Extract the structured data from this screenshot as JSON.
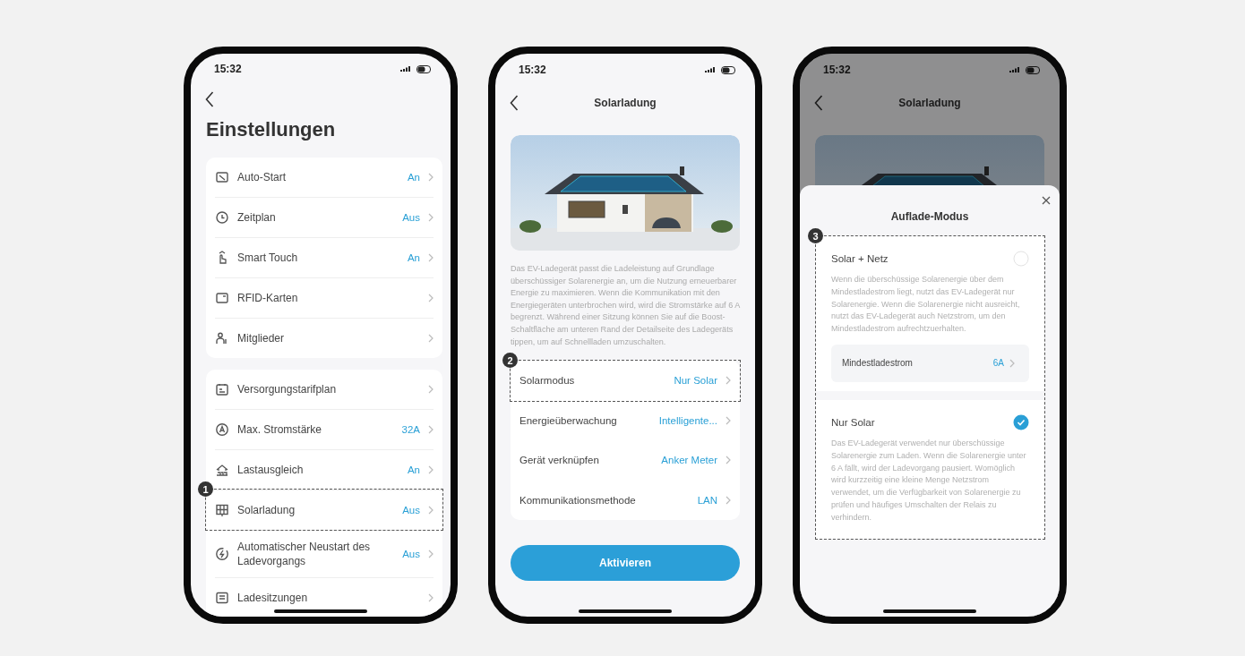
{
  "screens": [
    {
      "kind": "settings",
      "status_time": "15:32",
      "title": "Einstellungen",
      "groups": [
        [
          {
            "label": "Auto-Start",
            "value": "An"
          },
          {
            "label": "Zeitplan",
            "value": "Aus"
          },
          {
            "label": "Smart Touch",
            "value": "An"
          },
          {
            "label": "RFID-Karten"
          },
          {
            "label": "Mitglieder"
          }
        ],
        [
          {
            "label": "Versorgungstarifplan"
          },
          {
            "label": "Max. Stromstärke",
            "value": "32A"
          },
          {
            "label": "Lastausgleich",
            "value": "An"
          },
          {
            "label": "Solarladung",
            "value": "Aus",
            "callout": "1"
          },
          {
            "label": "Automatischer Neustart des Ladevorgangs",
            "value": "Aus"
          },
          {
            "label": "Ladesitzungen"
          }
        ]
      ]
    },
    {
      "kind": "detail",
      "status_time": "15:32",
      "title": "Solarladung",
      "description": "Das EV-Ladegerät passt die Ladeleistung auf Grundlage überschüssiger Solarenergie an, um die Nutzung erneuerbarer Energie zu maximieren. Wenn die Kommunikation mit den Energiegeräten unterbrochen wird, wird die Stromstärke auf 6 A begrenzt. Während einer Sitzung können Sie auf die Boost-Schaltfläche am unteren Rand der Detailseite des Ladegeräts tippen, um auf Schnellladen umzuschalten.",
      "rows": [
        {
          "label": "Solarmodus",
          "value": "Nur Solar",
          "callout": "2"
        },
        {
          "label": "Energieüberwachung",
          "value": "Intelligente..."
        },
        {
          "label": "Gerät verknüpfen",
          "value": "Anker Meter"
        },
        {
          "label": "Kommunikationsmethode",
          "value": "LAN"
        }
      ],
      "button": "Aktivieren"
    },
    {
      "kind": "sheet",
      "status_time": "15:32",
      "title": "Solarladung",
      "sheet": {
        "title": "Auflade-Modus",
        "callout": "3",
        "options": [
          {
            "name": "Solar + Netz",
            "selected": false,
            "description": "Wenn die überschüssige Solarenergie über dem Mindestladestrom liegt, nutzt das EV-Ladegerät nur Solarenergie. Wenn die Solarenergie nicht ausreicht, nutzt das EV-Ladegerät auch Netzstrom, um den Mindestladestrom aufrechtzuerhalten.",
            "sub_row": {
              "label": "Mindestladestrom",
              "value": "6A"
            }
          },
          {
            "name": "Nur Solar",
            "selected": true,
            "description": "Das EV-Ladegerät verwendet nur überschüssige Solarenergie zum Laden. Wenn die Solarenergie unter 6 A fällt, wird der Ladevorgang pausiert. Womöglich wird kurzzeitig eine kleine Menge Netzstrom verwendet, um die Verfügbarkeit von Solarenergie zu prüfen und häufiges Umschalten der Relais zu verhindern."
          }
        ]
      }
    }
  ]
}
